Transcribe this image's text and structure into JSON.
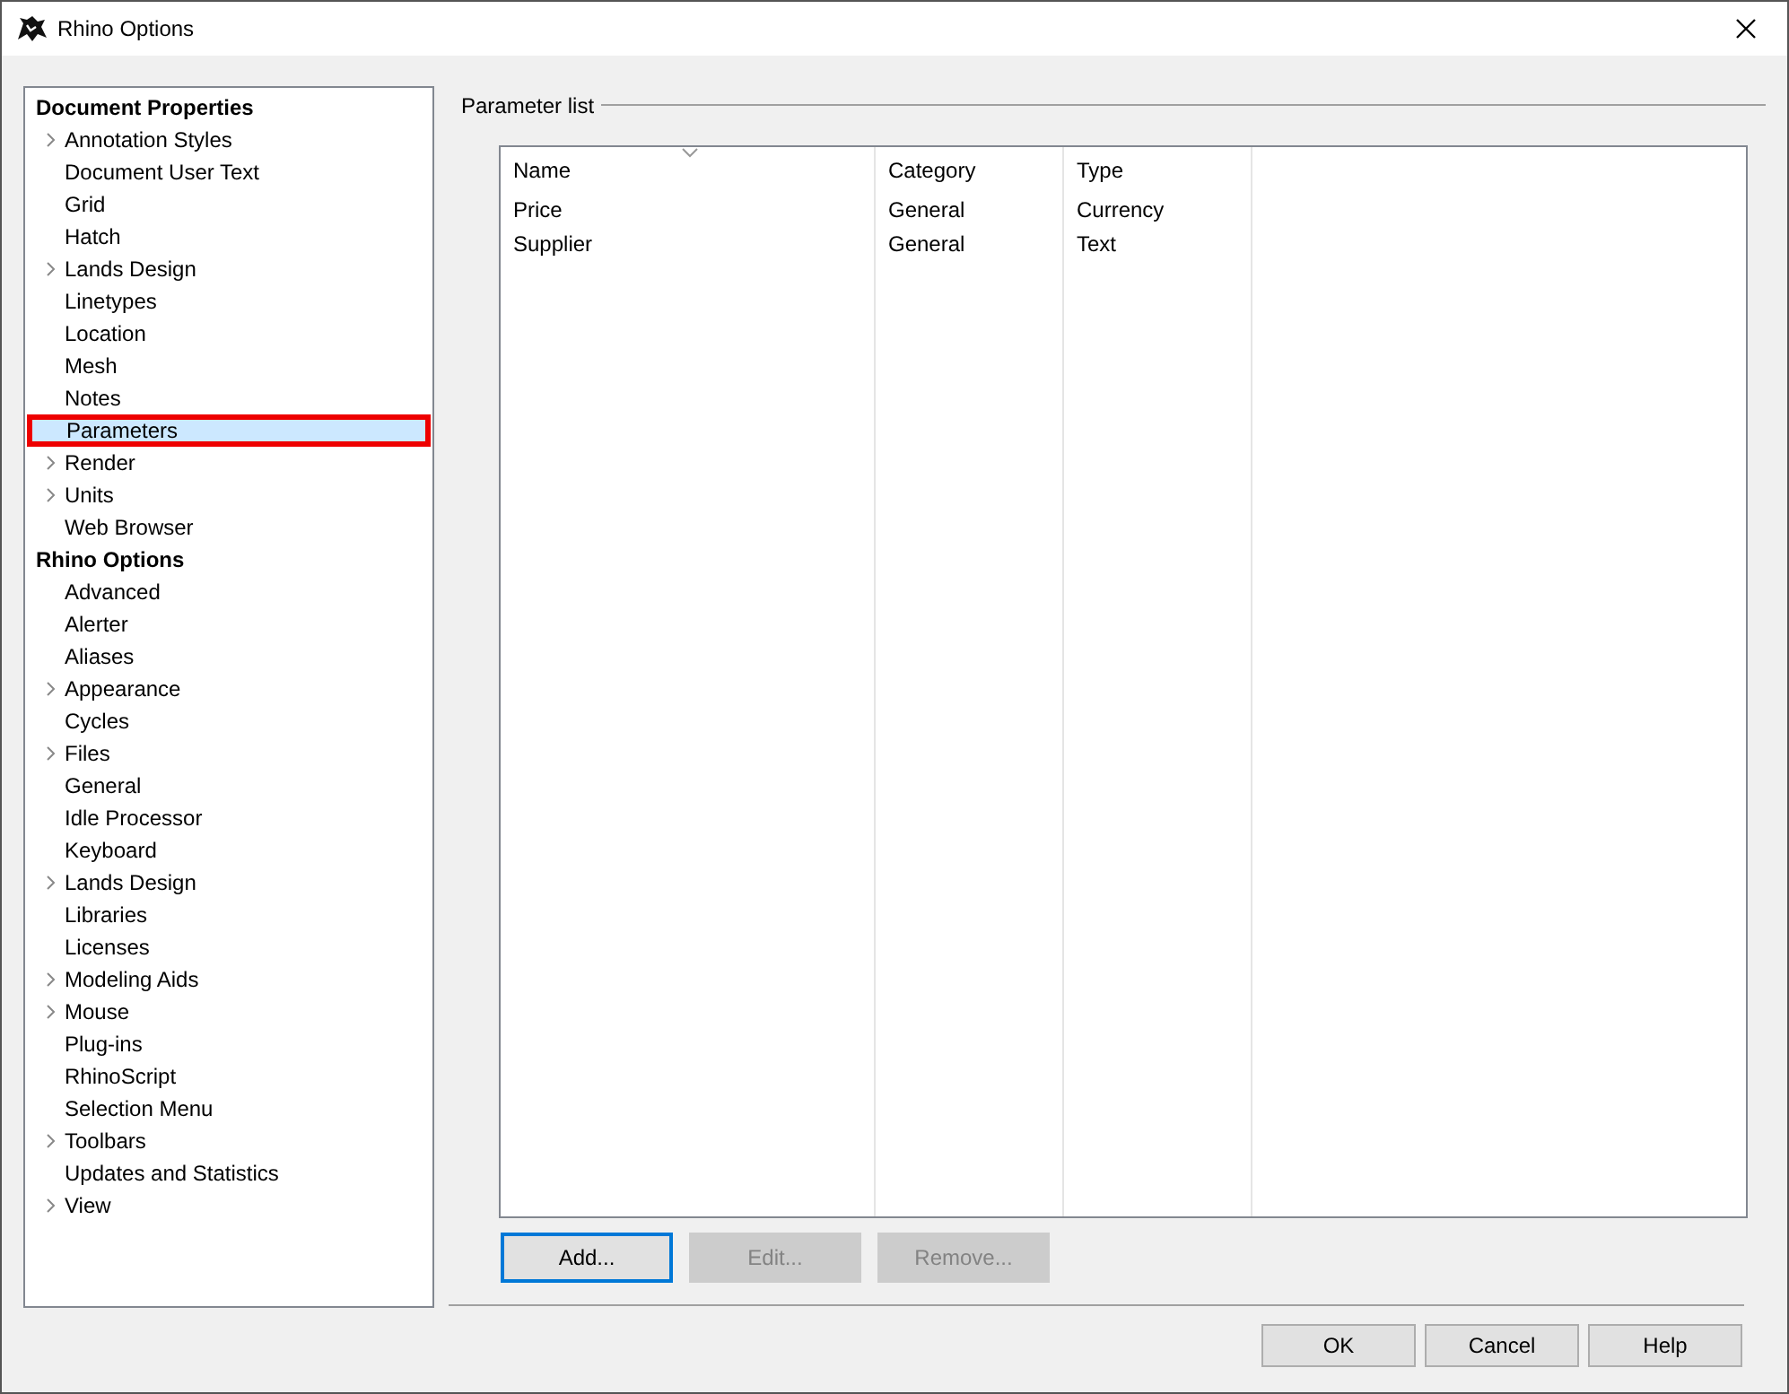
{
  "window": {
    "title": "Rhino Options"
  },
  "tree": [
    {
      "label": "Document Properties",
      "children": [
        {
          "label": "Annotation Styles",
          "expandable": true,
          "selected": false
        },
        {
          "label": "Document User Text",
          "expandable": false,
          "selected": false
        },
        {
          "label": "Grid",
          "expandable": false,
          "selected": false
        },
        {
          "label": "Hatch",
          "expandable": false,
          "selected": false
        },
        {
          "label": "Lands Design",
          "expandable": true,
          "selected": false
        },
        {
          "label": "Linetypes",
          "expandable": false,
          "selected": false
        },
        {
          "label": "Location",
          "expandable": false,
          "selected": false
        },
        {
          "label": "Mesh",
          "expandable": false,
          "selected": false
        },
        {
          "label": "Notes",
          "expandable": false,
          "selected": false
        },
        {
          "label": "Parameters",
          "expandable": false,
          "selected": true
        },
        {
          "label": "Render",
          "expandable": true,
          "selected": false
        },
        {
          "label": "Units",
          "expandable": true,
          "selected": false
        },
        {
          "label": "Web Browser",
          "expandable": false,
          "selected": false
        }
      ]
    },
    {
      "label": "Rhino Options",
      "children": [
        {
          "label": "Advanced",
          "expandable": false,
          "selected": false
        },
        {
          "label": "Alerter",
          "expandable": false,
          "selected": false
        },
        {
          "label": "Aliases",
          "expandable": false,
          "selected": false
        },
        {
          "label": "Appearance",
          "expandable": true,
          "selected": false
        },
        {
          "label": "Cycles",
          "expandable": false,
          "selected": false
        },
        {
          "label": "Files",
          "expandable": true,
          "selected": false
        },
        {
          "label": "General",
          "expandable": false,
          "selected": false
        },
        {
          "label": "Idle Processor",
          "expandable": false,
          "selected": false
        },
        {
          "label": "Keyboard",
          "expandable": false,
          "selected": false
        },
        {
          "label": "Lands Design",
          "expandable": true,
          "selected": false
        },
        {
          "label": "Libraries",
          "expandable": false,
          "selected": false
        },
        {
          "label": "Licenses",
          "expandable": false,
          "selected": false
        },
        {
          "label": "Modeling Aids",
          "expandable": true,
          "selected": false
        },
        {
          "label": "Mouse",
          "expandable": true,
          "selected": false
        },
        {
          "label": "Plug-ins",
          "expandable": false,
          "selected": false
        },
        {
          "label": "RhinoScript",
          "expandable": false,
          "selected": false
        },
        {
          "label": "Selection Menu",
          "expandable": false,
          "selected": false
        },
        {
          "label": "Toolbars",
          "expandable": true,
          "selected": false
        },
        {
          "label": "Updates and Statistics",
          "expandable": false,
          "selected": false
        },
        {
          "label": "View",
          "expandable": true,
          "selected": false
        }
      ]
    }
  ],
  "parameter_list": {
    "title": "Parameter list",
    "columns": [
      "Name",
      "Category",
      "Type"
    ],
    "rows": [
      [
        "Price",
        "General",
        "Currency"
      ],
      [
        "Supplier",
        "General",
        "Text"
      ]
    ],
    "buttons": [
      {
        "label": "Add...",
        "disabled": false
      },
      {
        "label": "Edit...",
        "disabled": true
      },
      {
        "label": "Remove...",
        "disabled": true
      }
    ]
  },
  "dialog_buttons": [
    "OK",
    "Cancel",
    "Help"
  ]
}
